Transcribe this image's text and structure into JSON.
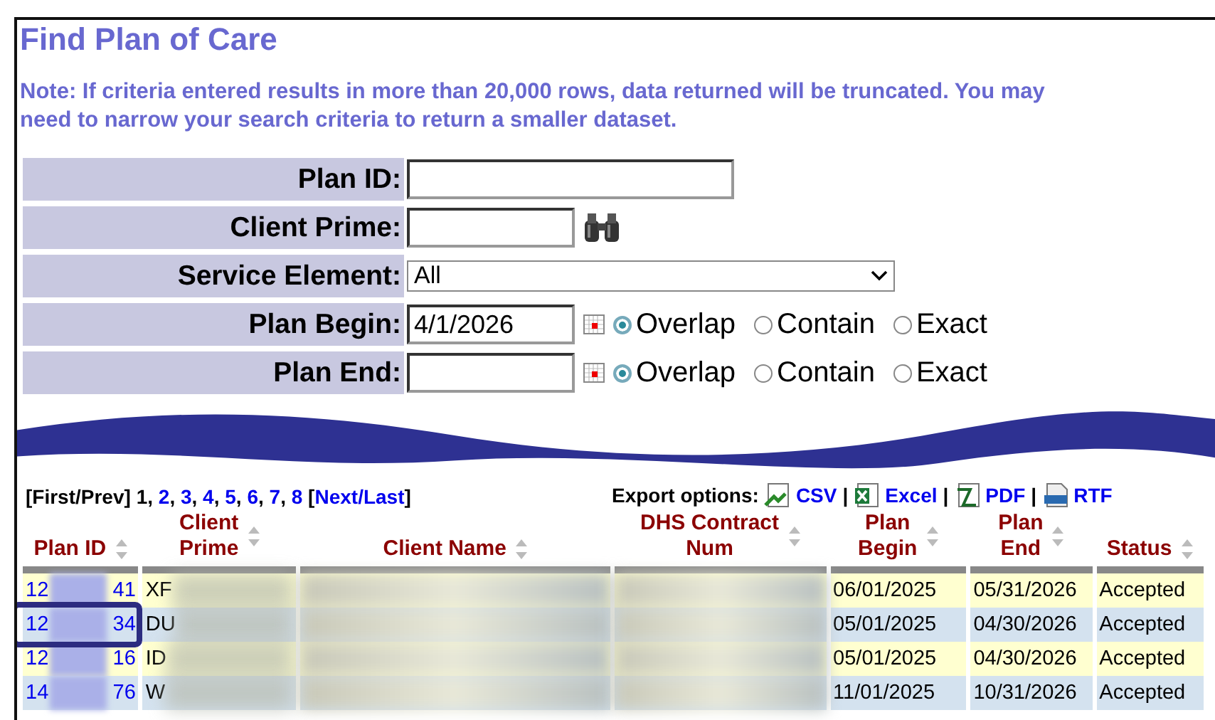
{
  "title": "Find Plan of Care",
  "note": "Note: If criteria entered results in more than 20,000 rows, data returned will be truncated. You may\nneed to narrow your search criteria to return a smaller dataset.",
  "form": [
    {
      "kind": "text",
      "label": "Plan ID:"
    },
    {
      "kind": "lookup",
      "label": "Client Prime:"
    },
    {
      "kind": "select",
      "label": "Service Element:",
      "value": "All"
    },
    {
      "kind": "date",
      "label": "Plan Begin:",
      "value": "4/1/2026",
      "modes": [
        {
          "label": "Overlap",
          "selected": true
        },
        {
          "label": "Contain",
          "selected": false
        },
        {
          "label": "Exact",
          "selected": false
        }
      ]
    },
    {
      "kind": "date",
      "label": "Plan End:",
      "modes": [
        {
          "label": "Overlap",
          "selected": true
        },
        {
          "label": "Contain",
          "selected": false
        },
        {
          "label": "Exact",
          "selected": false
        }
      ]
    }
  ],
  "pagination": {
    "first_prev": "[First/Prev]",
    "separator": ",",
    "pages": [
      {
        "label": "1",
        "selected": true
      },
      {
        "label": "2",
        "selected": false
      },
      {
        "label": "3",
        "selected": false
      },
      {
        "label": "4",
        "selected": false
      },
      {
        "label": "5",
        "selected": false
      },
      {
        "label": "6",
        "selected": false
      },
      {
        "label": "7",
        "selected": false
      },
      {
        "label": "8",
        "selected": false
      }
    ],
    "open_bracket": "[",
    "next_last": "Next/Last",
    "close_bracket": "]"
  },
  "export": {
    "label": "Export options:",
    "separator": "|",
    "items": [
      {
        "kind": "csv",
        "label": "CSV"
      },
      {
        "kind": "excel",
        "label": "Excel"
      },
      {
        "kind": "pdf",
        "label": "PDF"
      },
      {
        "kind": "rtf",
        "label": "RTF"
      }
    ]
  },
  "table": {
    "columns": [
      [
        "Plan ID"
      ],
      [
        "Client",
        "Prime"
      ],
      [
        "Client Name"
      ],
      [
        "DHS Contract",
        "Num"
      ],
      [
        "Plan",
        "Begin"
      ],
      [
        "Plan",
        "End"
      ],
      [
        "Status"
      ]
    ],
    "rows": [
      {
        "plan_id_start": "12",
        "plan_id_end": "41",
        "client_prime": "XF",
        "redacted": true,
        "plan_begin": "06/01/2025",
        "plan_end": "05/31/2026",
        "status": "Accepted",
        "highlighted": false
      },
      {
        "plan_id_start": "12",
        "plan_id_end": "34",
        "client_prime": "DU",
        "redacted": true,
        "plan_begin": "05/01/2025",
        "plan_end": "04/30/2026",
        "status": "Accepted",
        "highlighted": true
      },
      {
        "plan_id_start": "12",
        "plan_id_end": "16",
        "client_prime": "ID",
        "redacted": true,
        "plan_begin": "05/01/2025",
        "plan_end": "04/30/2026",
        "status": "Accepted",
        "highlighted": false
      },
      {
        "plan_id_start": "14",
        "plan_id_end": "76",
        "client_prime": "W",
        "redacted": true,
        "plan_begin": "11/01/2025",
        "plan_end": "10/31/2026",
        "status": "Accepted",
        "highlighted": false
      }
    ]
  }
}
